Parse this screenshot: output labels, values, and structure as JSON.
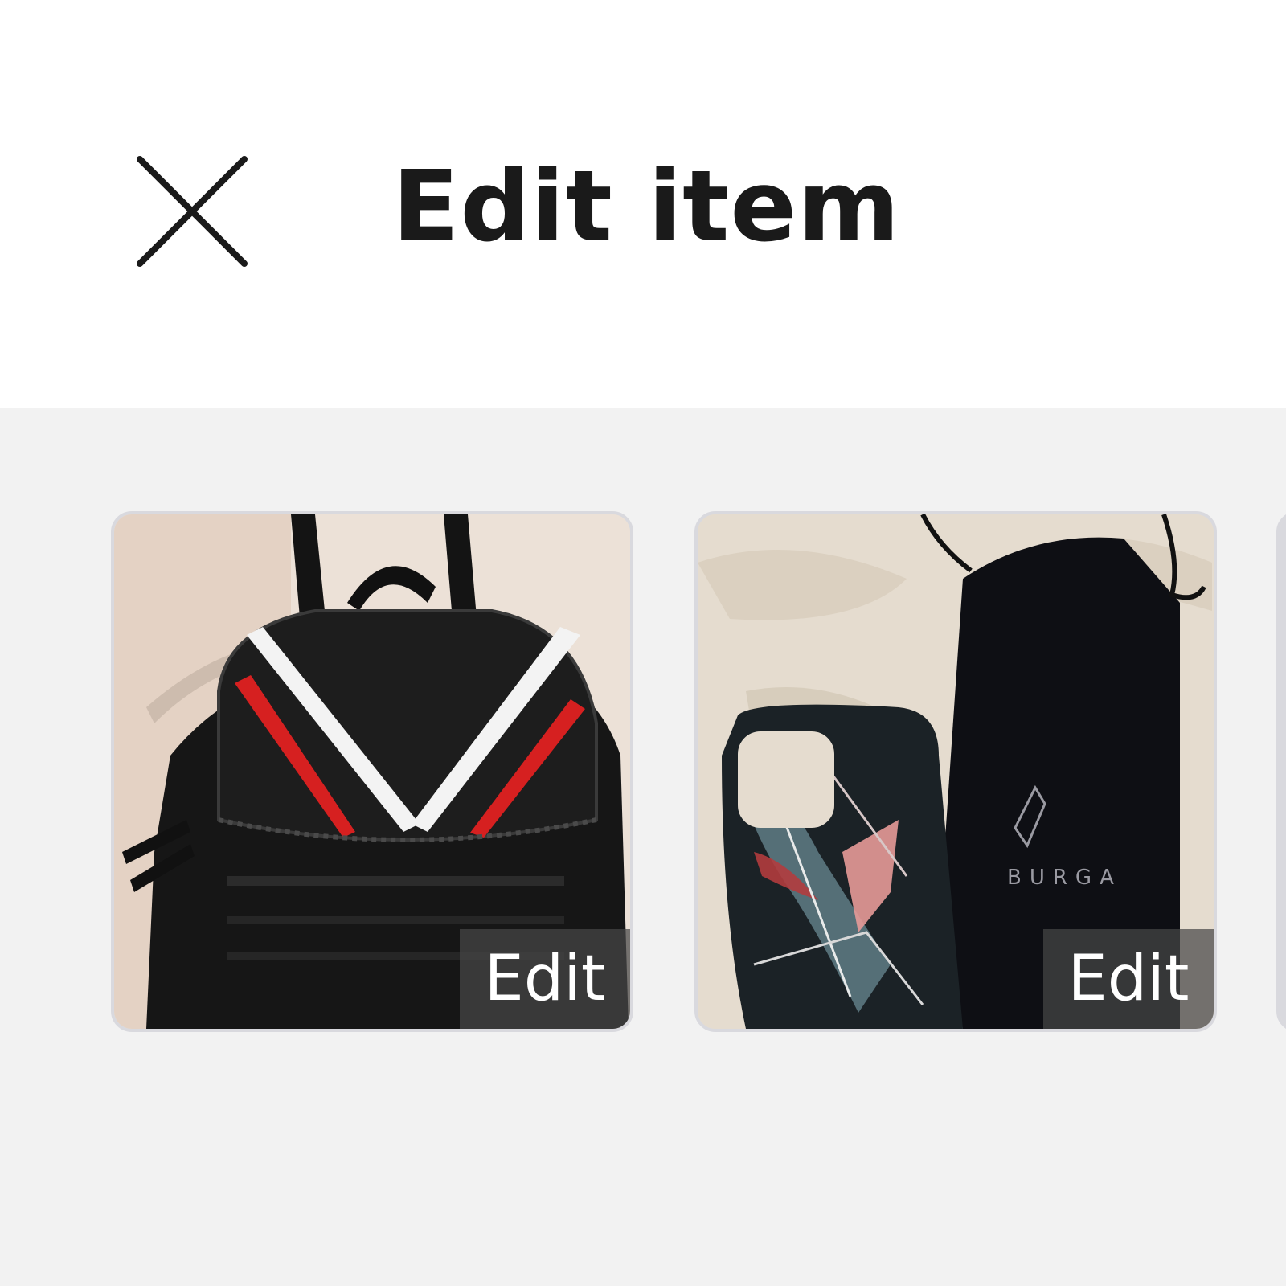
{
  "header": {
    "title": "Edit item",
    "close_icon": "close-icon"
  },
  "photos": [
    {
      "name": "backpack-photo",
      "edit_label": "Edit"
    },
    {
      "name": "phone-case-photo",
      "edit_label": "Edit",
      "brand_text": "BURGA"
    },
    {
      "name": "third-photo"
    }
  ],
  "colors": {
    "header_bg": "#ffffff",
    "gallery_bg": "#f2f2f2",
    "title_text": "#1a1a1a",
    "edit_overlay": "#464646"
  }
}
